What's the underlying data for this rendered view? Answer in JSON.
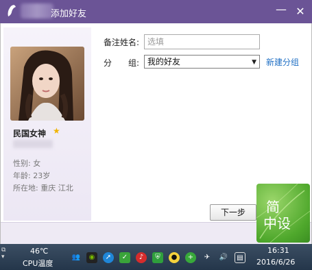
{
  "window": {
    "title": "添加好友",
    "minimize_glyph": "—",
    "close_glyph": "✕"
  },
  "profile": {
    "nickname": "民国女神",
    "gender_label": "性别:",
    "gender": "女",
    "age_label": "年龄:",
    "age": "23岁",
    "location_label": "所在地:",
    "location": "重庆  江北"
  },
  "form": {
    "remark_label": "备注姓名:",
    "remark_placeholder": "选填",
    "group_label": "分　　组:",
    "group_value": "我的好友",
    "new_group_link": "新建分组"
  },
  "footer": {
    "next_button": "下一步"
  },
  "watermark": {
    "line1": "简",
    "line2": "中设"
  },
  "taskbar": {
    "temperature": "46℃",
    "cpu_label": "CPU温度",
    "time": "16:31",
    "date": "2016/6/26",
    "icons": [
      "people-icon",
      "nvidia-icon",
      "safari-icon",
      "security-icon",
      "netease-music-icon",
      "shield-icon",
      "qq-penguin-icon",
      "plus-icon",
      "network-icon",
      "volume-icon",
      "action-center-icon"
    ]
  },
  "colors": {
    "titlebar": "#6b5496",
    "link": "#1f6fc4",
    "watermark_green": "#4fa82c"
  }
}
